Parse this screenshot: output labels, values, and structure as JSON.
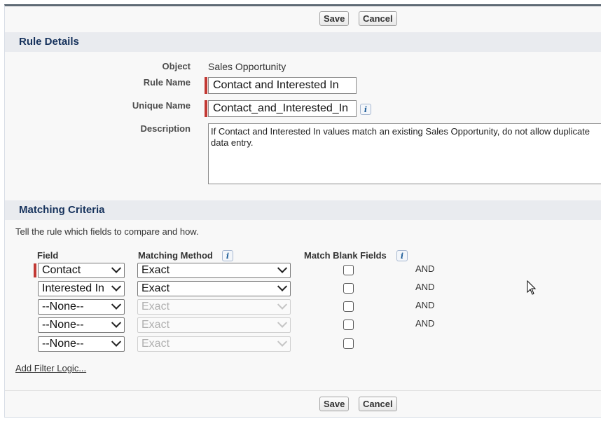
{
  "toolbar": {
    "save_label": "Save",
    "cancel_label": "Cancel"
  },
  "rule_details": {
    "heading": "Rule Details",
    "object_label": "Object",
    "object_value": "Sales Opportunity",
    "rule_name_label": "Rule Name",
    "rule_name_value": "Contact and Interested In",
    "unique_name_label": "Unique Name",
    "unique_name_value": "Contact_and_Interested_In",
    "description_label": "Description",
    "description_value": "If Contact and Interested In values match an existing Sales Opportunity, do not allow duplicate data entry."
  },
  "matching": {
    "heading": "Matching Criteria",
    "instructions": "Tell the rule which fields to compare and how.",
    "col_field": "Field",
    "col_method": "Matching Method",
    "col_blank": "Match Blank Fields",
    "rows": [
      {
        "field": "Contact",
        "method": "Exact",
        "conjunction": "AND"
      },
      {
        "field": "Interested In",
        "method": "Exact",
        "conjunction": "AND"
      },
      {
        "field": "--None--",
        "method": "Exact",
        "conjunction": "AND"
      },
      {
        "field": "--None--",
        "method": "Exact",
        "conjunction": "AND"
      },
      {
        "field": "--None--",
        "method": "Exact",
        "conjunction": ""
      }
    ],
    "filter_link": "Add Filter Logic...",
    "info_icon_glyph": "i"
  }
}
